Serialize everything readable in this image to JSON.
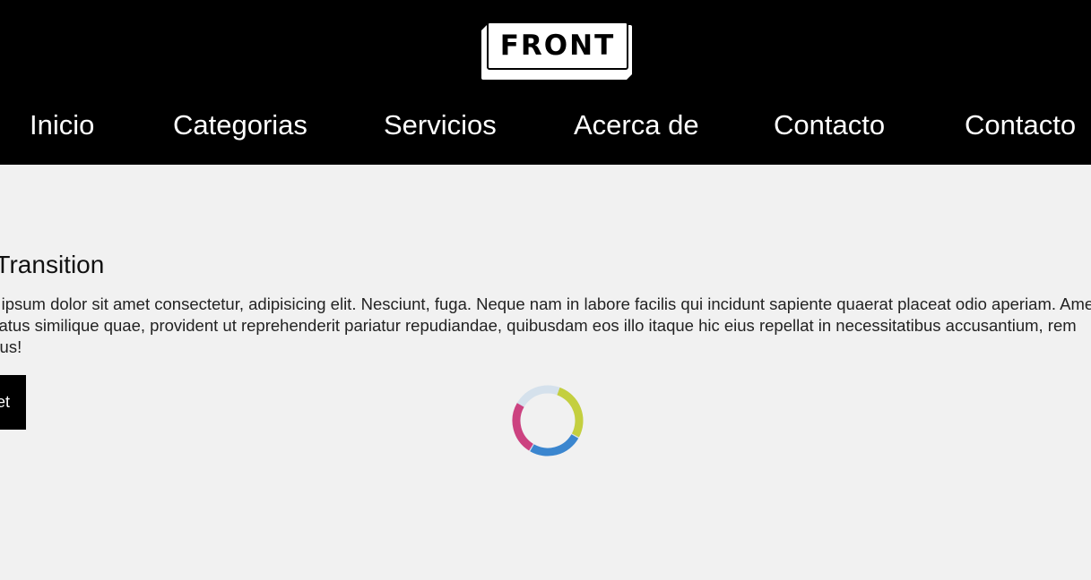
{
  "header": {
    "logo_text": "FRONT",
    "nav": [
      {
        "label": "Inicio"
      },
      {
        "label": "Categorias"
      },
      {
        "label": "Servicios"
      },
      {
        "label": "Acerca de"
      },
      {
        "label": "Contacto"
      },
      {
        "label": "Contacto"
      }
    ]
  },
  "main": {
    "heading": "Lazy Transition",
    "paragraph_lines": [
      "Lorem ipsum dolor sit amet consectetur, adipisicing elit. Nesciunt, fuga. Neque nam in labore facilis qui incidunt sapiente quaerat placeat odio aperiam. Amet",
      "iusto natus similique quae, provident ut reprehenderit pariatur repudiandae, quibusdam eos illo itaque hic eius repellat in necessitatibus accusantium, rem",
      "doloribus!"
    ],
    "button_label": "Get"
  },
  "spinner": {
    "icon": "loading-spinner-icon",
    "colors": {
      "track": "#d5e1ec",
      "green": "#c4cf3f",
      "blue": "#3b86cf",
      "pink": "#cc4280"
    }
  },
  "colors": {
    "header_bg": "#000000",
    "page_bg": "#f1f1f1",
    "button_bg": "#000000"
  }
}
